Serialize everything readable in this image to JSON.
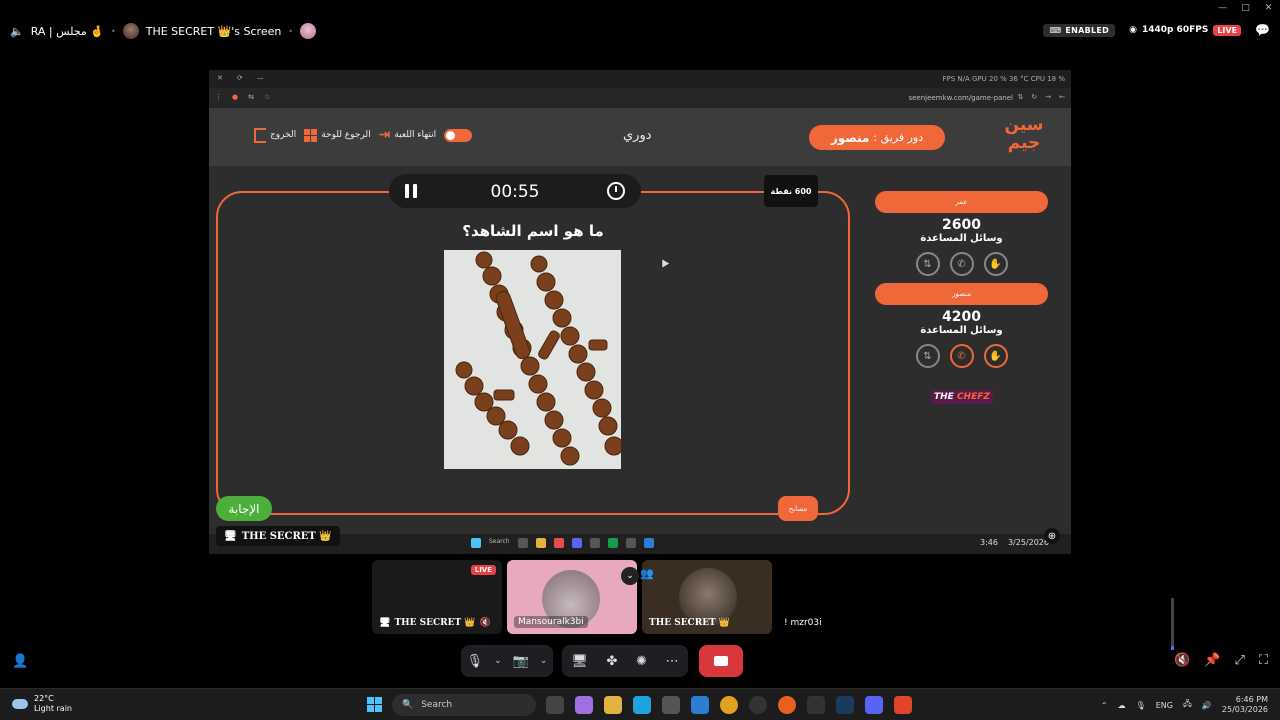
{
  "window": {
    "controls": [
      "—",
      "□",
      "✕"
    ]
  },
  "call": {
    "channel": "RA | مجلس 🤞",
    "screen_owner": "THE SECRET 👑's Screen",
    "enabled_badge": "ENABLED",
    "quality": "1440p 60FPS",
    "live_badge": "LIVE"
  },
  "browser": {
    "perf": "FPS N/A   GPU 20 % 36 °C   CPU 18 %",
    "url": "seenjeemkw.com/game-panel"
  },
  "game": {
    "logo": "سين جيم",
    "turn_label": "دور فريق :",
    "turn_team": "منصور",
    "league": "دوري",
    "actions": {
      "exit": "الخروج",
      "back_to_board": "الرجوع للوحة",
      "end_game": "انتهاء اللعبة"
    },
    "timer": "00:55",
    "points": "600 نقطة",
    "question": "ما هو اسم الشاهد؟",
    "answer_button": "الإجابة",
    "sponsors_button": "مسابح",
    "teams": [
      {
        "name": "عمر",
        "score": "2600",
        "help_label": "وسائل المساعدة"
      },
      {
        "name": "منصور",
        "score": "4200",
        "help_label": "وسائل المساعدة"
      }
    ],
    "sponsor": {
      "the": "THE ",
      "chefz": "CHEFZ"
    }
  },
  "inner_taskbar": {
    "search": "Search",
    "time": "3:46",
    "date": "3/25/2026"
  },
  "streamer_tag": "THE SECRET 👑",
  "participants": [
    {
      "name": "THE SECRET 👑",
      "live": "LIVE"
    },
    {
      "name": "Mansouralk3bi"
    },
    {
      "name": "THE SECRET 👑"
    },
    {
      "name": "! mzr03i"
    }
  ],
  "taskbar": {
    "temp": "22°C",
    "weather": "Light rain",
    "search": "Search",
    "lang": "ENG",
    "time": "6:46 PM",
    "date": "25/03/2026"
  }
}
